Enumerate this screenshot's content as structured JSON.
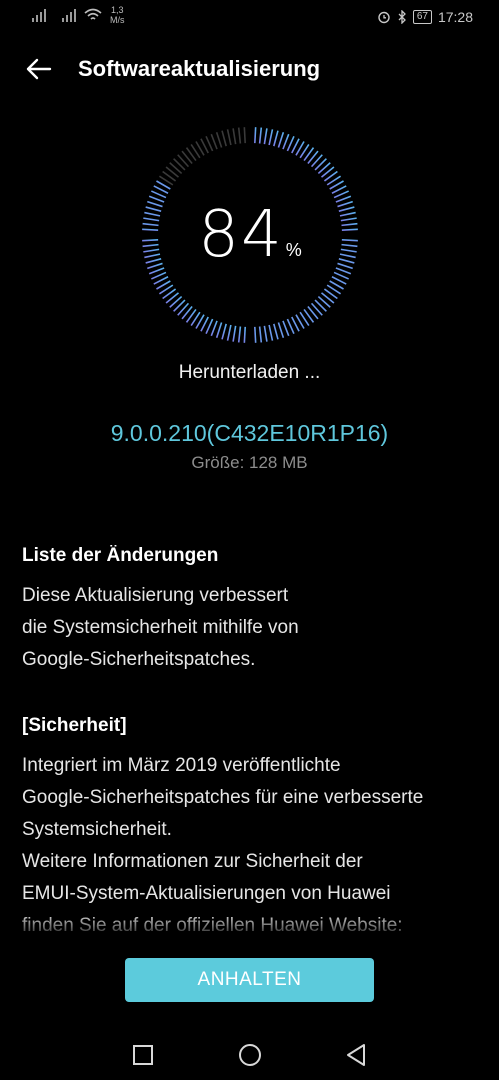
{
  "status_bar": {
    "net_speed_value": "1,3",
    "net_speed_unit": "M/s",
    "battery": "67",
    "time": "17:28",
    "icons": [
      "signal-icon",
      "signal-icon",
      "wifi-icon",
      "alarm-icon",
      "bluetooth-icon",
      "battery-icon"
    ]
  },
  "header": {
    "title": "Softwareaktualisierung",
    "back_icon": "arrow-left-icon"
  },
  "progress": {
    "value": 84,
    "percent_text": "84",
    "unit": "%",
    "status": "Herunterladen ..."
  },
  "version": "9.0.0.210(C432E10R1P16)",
  "size_text": "Größe: 128 MB",
  "changelog": {
    "heading": "Liste der Änderungen",
    "intro": "Diese Aktualisierung verbessert\ndie Systemsicherheit mithilfe von\nGoogle-Sicherheitspatches.",
    "section_heading": "[Sicherheit]",
    "section_text": "Integriert im März 2019 veröffentlichte\nGoogle-Sicherheitspatches für eine verbesserte\nSystemsicherheit.\nWeitere Informationen zur Sicherheit der\nEMUI-System-Aktualisierungen von Huawei\nfinden Sie auf der offiziellen Huawei Website:"
  },
  "action_button": "ANHALTEN",
  "colors": {
    "accent": "#5ccbdc",
    "version_text": "#5fc7dc",
    "dial_gradient_start": "#7b7ee6",
    "dial_gradient_end": "#5ab2ee",
    "dial_inactive": "#3a3a3a"
  },
  "nav": {
    "icons": [
      "recent-apps-icon",
      "home-icon",
      "back-triangle-icon"
    ]
  }
}
